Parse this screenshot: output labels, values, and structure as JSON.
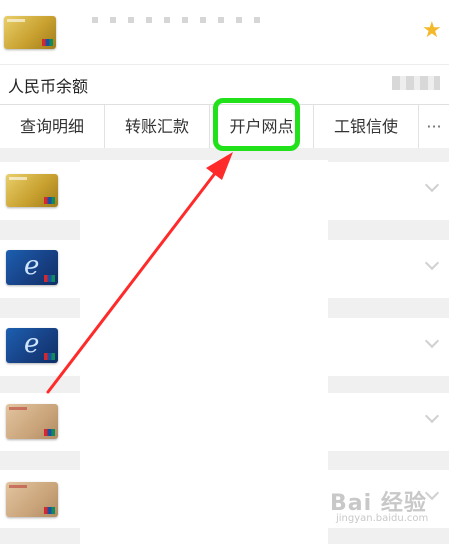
{
  "account": {
    "balance_label": "人民币余额",
    "favorite_icon": "star-icon"
  },
  "actions": [
    {
      "label": "查询明细"
    },
    {
      "label": "转账汇款"
    },
    {
      "label": "开户网点"
    },
    {
      "label": "工银信使"
    },
    {
      "label": "···"
    }
  ],
  "cards": [
    {
      "style": "gold"
    },
    {
      "style": "blue"
    },
    {
      "style": "blue"
    },
    {
      "style": "tan"
    },
    {
      "style": "tan"
    }
  ],
  "annotation": {
    "highlight_color": "#21e21a",
    "arrow_color": "#ff2a2a"
  },
  "watermark": {
    "text": "Bai 经验",
    "sub": "jingyan.baidu.com"
  }
}
